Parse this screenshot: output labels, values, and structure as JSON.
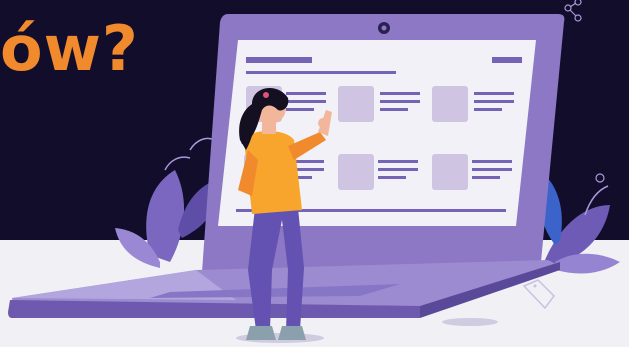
{
  "banner": {
    "headline": "ów?",
    "colors": {
      "background": "#130d2c",
      "floor": "#f1f0f5",
      "headline": "#f08a2c",
      "laptop": "#8c78c4",
      "screen": "#f2f1f8",
      "card": "#cfc5e3",
      "line": "#7563b6"
    }
  },
  "illustration": {
    "subject": "woman-pointing-at-laptop",
    "icons": [
      "plant-leaf-icon",
      "price-tag-icon",
      "share-icon"
    ]
  }
}
